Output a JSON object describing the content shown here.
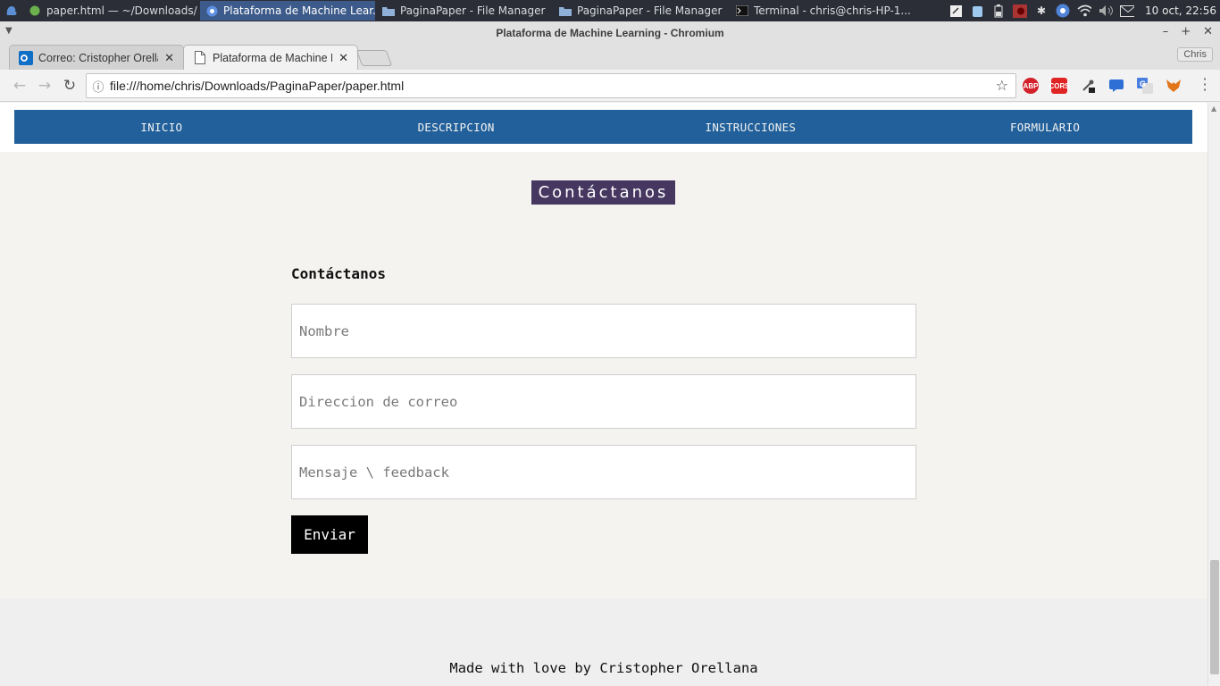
{
  "taskbar": {
    "tasks": [
      {
        "label": "paper.html — ~/Downloads/...",
        "icon": "circle-green-icon"
      },
      {
        "label": "Plataforma de Machine Lear...",
        "icon": "chromium-icon"
      },
      {
        "label": "PaginaPaper - File Manager",
        "icon": "folder-icon"
      },
      {
        "label": "PaginaPaper - File Manager",
        "icon": "folder-icon"
      },
      {
        "label": "Terminal - chris@chris-HP-1...",
        "icon": "terminal-icon"
      }
    ],
    "clock": "10 oct, 22:56"
  },
  "window": {
    "title": "Plataforma de Machine Learning - Chromium",
    "profile": "Chris"
  },
  "tabs": [
    {
      "label": "Correo: Cristopher Orellana",
      "icon": "outlook-icon",
      "active": false
    },
    {
      "label": "Plataforma de Machine Learning",
      "icon": "document-icon",
      "active": true
    }
  ],
  "toolbar": {
    "url": "file:///home/chris/Downloads/PaginaPaper/paper.html",
    "extensions": [
      {
        "name": "adblock-plus-icon",
        "text": "ABP",
        "color": "#d3212b"
      },
      {
        "name": "cors-icon",
        "text": "CORS",
        "color": "#e02424"
      },
      {
        "name": "eyedropper-icon",
        "text": "",
        "color": "#555555"
      },
      {
        "name": "chat-icon",
        "text": "",
        "color": "#2e6fd6"
      },
      {
        "name": "translate-icon",
        "text": "",
        "color": "#4a7fe0"
      },
      {
        "name": "metamask-icon",
        "text": "",
        "color": "#e2761b"
      }
    ]
  },
  "page": {
    "nav": [
      "INICIO",
      "DESCRIPCION",
      "INSTRUCCIONES",
      "FORMULARIO"
    ],
    "section_title": "Contáctanos",
    "form": {
      "heading": "Contáctanos",
      "name_placeholder": "Nombre",
      "email_placeholder": "Direccion de correo",
      "message_placeholder": "Mensaje \\ feedback",
      "submit_label": "Enviar"
    },
    "footer": "Made with love by Cristopher Orellana"
  },
  "colors": {
    "nav_bg": "#21609a",
    "title_bg": "#453760",
    "page_bg": "#f4f3ef"
  }
}
